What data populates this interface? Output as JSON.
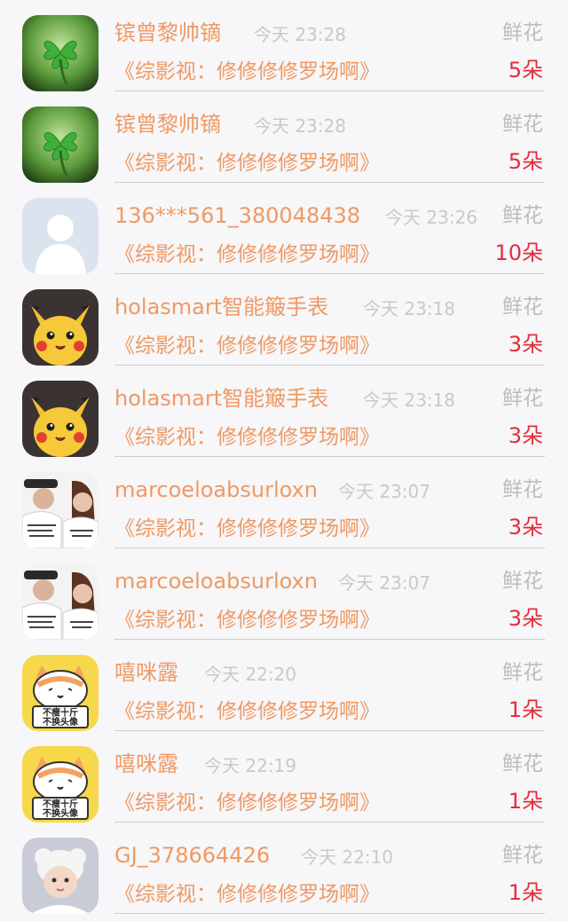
{
  "rows": [
    {
      "name": "镔曾黎帅镝",
      "time": "今天 23:28",
      "gift": "鲜花",
      "book": "《综影视：修修修修罗场啊》",
      "count": "5朵",
      "avatar": "clover-avatar"
    },
    {
      "name": "镔曾黎帅镝",
      "time": "今天 23:28",
      "gift": "鲜花",
      "book": "《综影视：修修修修罗场啊》",
      "count": "5朵",
      "avatar": "clover-avatar"
    },
    {
      "name": "136***561_380048438",
      "time": "今天 23:26",
      "gift": "鲜花",
      "book": "《综影视：修修修修罗场啊》",
      "count": "10朵",
      "avatar": "default-user-avatar"
    },
    {
      "name": "holasmart智能簸手表",
      "time": "今天 23:18",
      "gift": "鲜花",
      "book": "《综影视：修修修修罗场啊》",
      "count": "3朵",
      "avatar": "pikachu-avatar"
    },
    {
      "name": "holasmart智能簸手表",
      "time": "今天 23:18",
      "gift": "鲜花",
      "book": "《综影视：修修修修罗场啊》",
      "count": "3朵",
      "avatar": "pikachu-avatar"
    },
    {
      "name": "marcoeloabsurloxn",
      "time": "今天 23:07",
      "gift": "鲜花",
      "book": "《综影视：修修修修罗场啊》",
      "count": "3朵",
      "avatar": "couple-photo-avatar"
    },
    {
      "name": "marcoeloabsurloxn",
      "time": "今天 23:07",
      "gift": "鲜花",
      "book": "《综影视：修修修修罗场啊》",
      "count": "3朵",
      "avatar": "couple-photo-avatar"
    },
    {
      "name": "嘻咪露",
      "time": "今天 22:20",
      "gift": "鲜花",
      "book": "《综影视：修修修修罗场啊》",
      "count": "1朵",
      "avatar": "cat-sticker-avatar"
    },
    {
      "name": "嘻咪露",
      "time": "今天 22:19",
      "gift": "鲜花",
      "book": "《综影视：修修修修罗场啊》",
      "count": "1朵",
      "avatar": "cat-sticker-avatar"
    },
    {
      "name": "GJ_378664426",
      "time": "今天 22:10",
      "gift": "鲜花",
      "book": "《综影视：修修修修罗场啊》",
      "count": "1朵",
      "avatar": "baby-photo-avatar"
    }
  ],
  "cat_sticker_text": "不瘦十斤不换头像",
  "colors": {
    "name": "#ee9a64",
    "book": "#ee9a64",
    "time": "#c9c9c9",
    "gift": "#bdbdbd",
    "count": "#e02f3c",
    "background": "#f7f6f8"
  }
}
